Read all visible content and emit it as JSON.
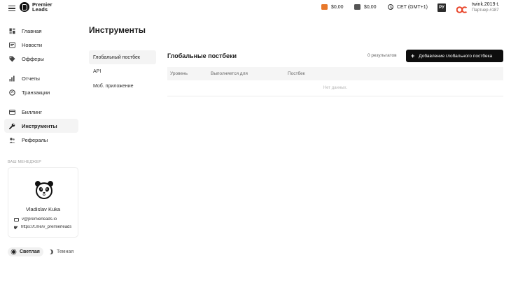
{
  "header": {
    "logo_line1": "Premier",
    "logo_line2": "Leads",
    "balance1": "$0,00",
    "balance2": "$0,00",
    "timezone": "CET (GMT+1)",
    "lang": "РУ",
    "user_name": "twink.2019 t.",
    "partner": "Партнер #187"
  },
  "sidebar": {
    "items": [
      {
        "label": "Главная"
      },
      {
        "label": "Новости"
      },
      {
        "label": "Офферы"
      },
      {
        "label": "Отчеты"
      },
      {
        "label": "Транзакции"
      },
      {
        "label": "Биллинг"
      },
      {
        "label": "Инструменты"
      },
      {
        "label": "Рефералы"
      }
    ],
    "manager_caption": "ВАШ МЕНЕДЖЕР",
    "manager_name": "Vladislav Kuka",
    "manager_email": "v@premierleads.io",
    "manager_telegram": "https://t.me/v_premierleads",
    "theme_light": "Светлая",
    "theme_dark": "Темная"
  },
  "main": {
    "title": "Инструменты",
    "subnav": [
      {
        "label": "Глобальный постбек"
      },
      {
        "label": "API"
      },
      {
        "label": "Моб. приложение"
      }
    ],
    "section_title": "Глобальные постбеки",
    "results": "0  результатов",
    "add_button": "Добавление глобального постбека",
    "table": {
      "columns": [
        "Уровень",
        "Выполняется для",
        "Постбек"
      ],
      "empty": "Нет данных."
    }
  }
}
